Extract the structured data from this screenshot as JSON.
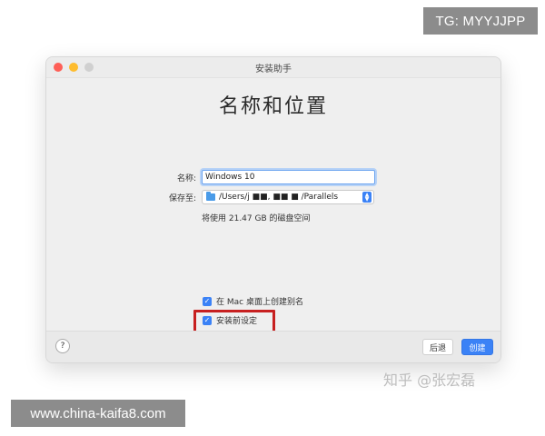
{
  "watermarks": {
    "tg": "TG: MYYJJPP",
    "site": "www.china-kaifa8.com",
    "zhihu": "知乎 @张宏磊"
  },
  "window": {
    "title": "安装助手",
    "heading": "名称和位置"
  },
  "form": {
    "name_label": "名称:",
    "name_value": "Windows 10",
    "save_label": "保存至:",
    "save_path": "/Users/j ■■, ■■ ■ /Parallels",
    "disk_note": "将使用 21.47 GB 的磁盘空间"
  },
  "options": {
    "alias_label": "在 Mac 桌面上创建别名",
    "alias_checked": true,
    "customize_label": "安装前设定",
    "customize_checked": true
  },
  "footer": {
    "help": "?",
    "back": "后退",
    "create": "创建"
  },
  "colors": {
    "accent": "#3b82f6",
    "highlight": "#c72020"
  }
}
